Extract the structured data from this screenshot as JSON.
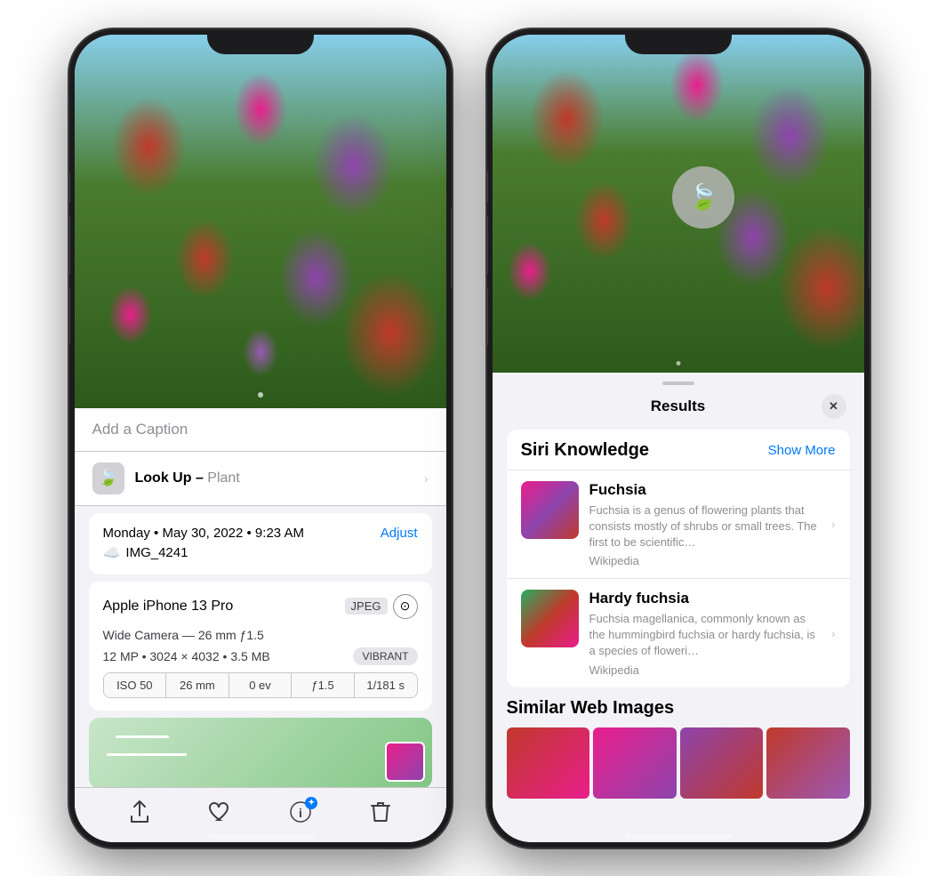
{
  "left_phone": {
    "caption_placeholder": "Add a Caption",
    "lookup_label": "Look Up –",
    "lookup_subject": " Plant",
    "lookup_chevron": "›",
    "date_line": "Monday • May 30, 2022 • 9:23 AM",
    "adjust_label": "Adjust",
    "filename": "IMG_4241",
    "device_name": "Apple iPhone 13 Pro",
    "badge_jpeg": "JPEG",
    "camera_spec": "Wide Camera — 26 mm ƒ1.5",
    "camera_spec2": "12 MP • 3024 × 4032 • 3.5 MB",
    "vibrant_label": "VIBRANT",
    "exif": [
      {
        "label": "ISO 50"
      },
      {
        "label": "26 mm"
      },
      {
        "label": "0 ev"
      },
      {
        "label": "ƒ1.5"
      },
      {
        "label": "1/181 s"
      }
    ],
    "toolbar": {
      "share": "⬆",
      "heart": "♡",
      "info": "ⓘ",
      "trash": "🗑"
    }
  },
  "right_phone": {
    "results_title": "Results",
    "close_label": "✕",
    "siri_leaf_icon": "🍃",
    "knowledge_title": "Siri Knowledge",
    "show_more": "Show More",
    "items": [
      {
        "name": "Fuchsia",
        "description": "Fuchsia is a genus of flowering plants that consists mostly of shrubs or small trees. The first to be scientific…",
        "source": "Wikipedia"
      },
      {
        "name": "Hardy fuchsia",
        "description": "Fuchsia magellanica, commonly known as the hummingbird fuchsia or hardy fuchsia, is a species of floweri…",
        "source": "Wikipedia"
      }
    ],
    "similar_title": "Similar Web Images"
  }
}
